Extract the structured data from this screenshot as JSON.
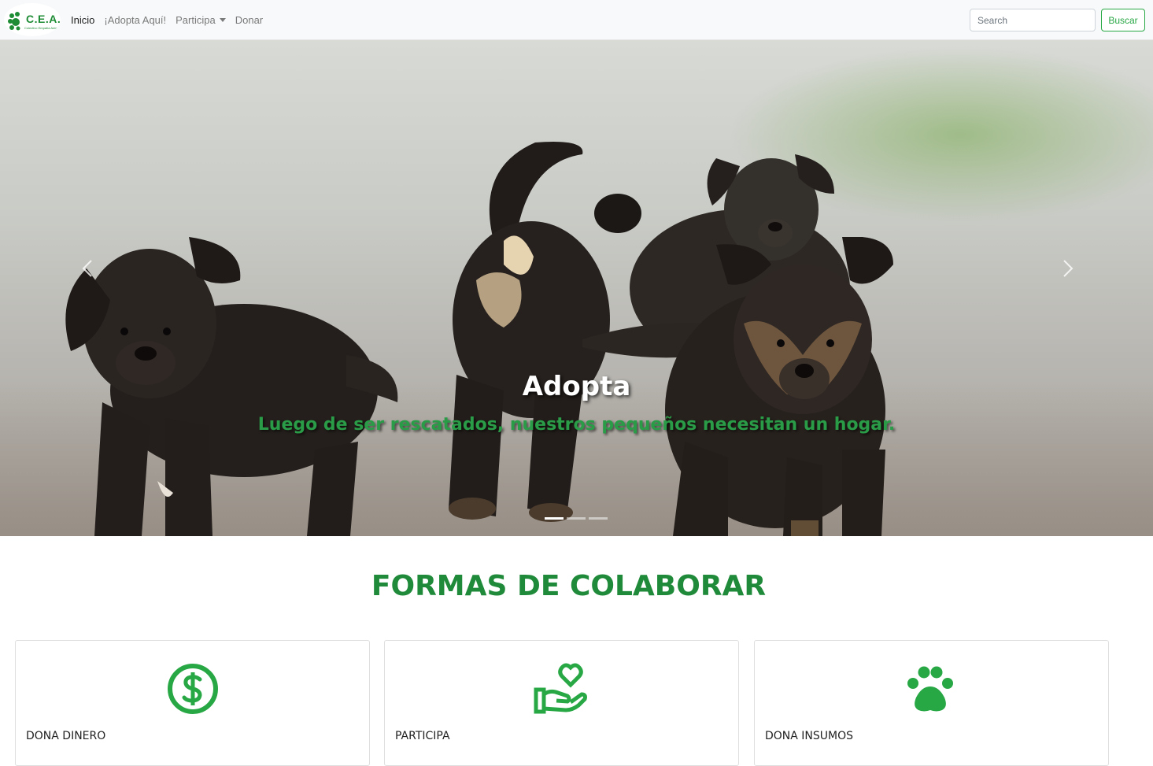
{
  "brand": {
    "logo_text": "C.E.A.",
    "logo_subtitle": "Colectivo Empatía Animal",
    "color": "#1e8c34"
  },
  "nav": {
    "links": [
      {
        "label": "Inicio",
        "active": true
      },
      {
        "label": "¡Adopta Aquí!",
        "active": false
      },
      {
        "label": "Participa",
        "active": false,
        "dropdown": true
      },
      {
        "label": "Donar",
        "active": false
      }
    ],
    "search_placeholder": "Search",
    "search_button": "Buscar"
  },
  "carousel": {
    "caption_title": "Adopta",
    "caption_subtitle": "Luego de ser rescatados, nuestros pequeños necesitan un hogar.",
    "slide_count": 3,
    "active_slide": 0,
    "image": "puppies-on-road"
  },
  "section": {
    "title": "FORMAS DE COLABORAR",
    "cards": [
      {
        "title": "DONA DINERO",
        "icon": "dollar-circle-icon"
      },
      {
        "title": "PARTICIPA",
        "icon": "hand-heart-icon"
      },
      {
        "title": "DONA INSUMOS",
        "icon": "paw-icon"
      }
    ]
  },
  "colors": {
    "accent": "#28a745",
    "heading": "#1f8a3a"
  }
}
